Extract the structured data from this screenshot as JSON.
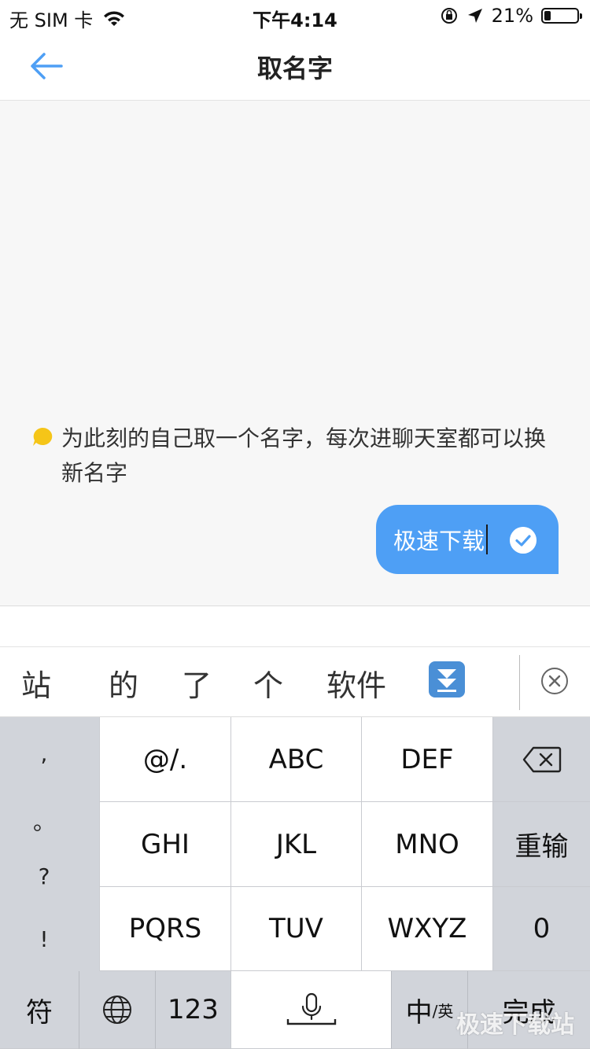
{
  "status_bar": {
    "carrier": "无 SIM 卡",
    "time": "下午4:14",
    "battery": "21%"
  },
  "nav": {
    "title": "取名字"
  },
  "chat": {
    "prompt": "为此刻的自己取一个名字，每次进聊天室都可以换新名字",
    "reply": "极速下载"
  },
  "candidates": [
    "站",
    "的",
    "了",
    "个",
    "软件"
  ],
  "keyboard": {
    "side": [
      ",",
      "。",
      "?",
      "!"
    ],
    "row1": [
      "@/.",
      "ABC",
      "DEF"
    ],
    "row2": [
      "GHI",
      "JKL",
      "MNO"
    ],
    "row2_action": "重输",
    "row3": [
      "PQRS",
      "TUV",
      "WXYZ"
    ],
    "row3_action": "0",
    "bottom": {
      "symbols": "符",
      "numbers": "123",
      "lang_main": "中",
      "lang_sub": "/英",
      "done": "完成"
    }
  },
  "watermark": "极速下载站",
  "colors": {
    "accent": "#4e9ff5",
    "prompt_icon": "#f5c518"
  }
}
